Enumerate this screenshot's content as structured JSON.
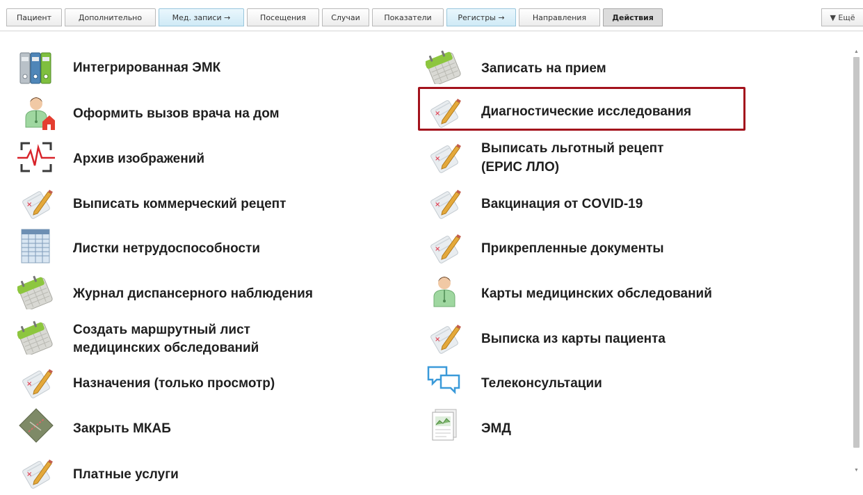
{
  "tabs": [
    {
      "label": "Пациент"
    },
    {
      "label": "Дополнительно"
    },
    {
      "label": "Мед. записи →"
    },
    {
      "label": "Посещения"
    },
    {
      "label": "Случаи"
    },
    {
      "label": "Показатели"
    },
    {
      "label": "Регистры →"
    },
    {
      "label": "Направления"
    },
    {
      "label": "Действия"
    }
  ],
  "more_label": "▼ Ещё",
  "actions_left": [
    {
      "label": "Интегрированная ЭМК",
      "icon": "emk-binders-icon"
    },
    {
      "label": "Оформить вызов врача на дом",
      "icon": "doctor-home-icon"
    },
    {
      "label": "Архив изображений",
      "icon": "image-archive-icon"
    },
    {
      "label": "Выписать коммерческий рецепт",
      "icon": "prescription-icon"
    },
    {
      "label": "Листки нетрудоспособности",
      "icon": "sick-leave-icon"
    },
    {
      "label": "Журнал диспансерного наблюдения",
      "icon": "calendar-icon"
    },
    {
      "label1": "Создать маршрутный лист",
      "label2": "медицинских обследований",
      "icon": "calendar-icon"
    },
    {
      "label": "Назначения (только просмотр)",
      "icon": "prescription-icon"
    },
    {
      "label": "Закрыть МКАБ",
      "icon": "close-card-icon"
    },
    {
      "label": "Платные услуги",
      "icon": "prescription-icon"
    }
  ],
  "actions_right": [
    {
      "label": "Записать на прием",
      "icon": "calendar-icon"
    },
    {
      "label": "Диагностические исследования",
      "icon": "prescription-icon"
    },
    {
      "label1": "Выписать льготный рецепт",
      "label2": "(ЕРИС ЛЛО)",
      "icon": "prescription-icon"
    },
    {
      "label": "Вакцинация от COVID-19",
      "icon": "prescription-icon"
    },
    {
      "label": "Прикрепленные документы",
      "icon": "prescription-icon"
    },
    {
      "label": "Карты медицинских обследований",
      "icon": "doctor-icon"
    },
    {
      "label": "Выписка из карты пациента",
      "icon": "prescription-icon"
    },
    {
      "label": "Телеконсультации",
      "icon": "chat-icon"
    },
    {
      "label": "ЭМД",
      "icon": "document-chart-icon"
    }
  ],
  "colors": {
    "highlight": "#a3121c",
    "tab_blue": "#cfeaf6",
    "tab_active": "#dcdcdc"
  }
}
